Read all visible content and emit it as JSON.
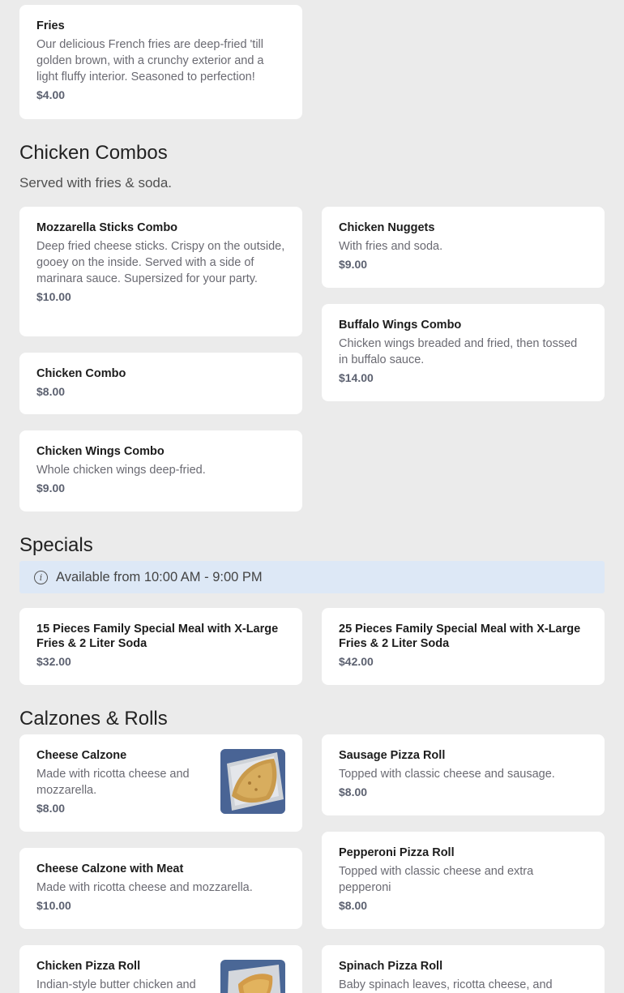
{
  "sections": {
    "sides": {
      "items": [
        {
          "name": "Fries",
          "desc": "Our delicious French fries are deep-fried 'till golden brown, with a crunchy exterior and a light fluffy interior. Seasoned to perfection!",
          "price": "$4.00"
        }
      ]
    },
    "chicken_combos": {
      "title": "Chicken Combos",
      "subtitle": "Served with fries & soda.",
      "items": [
        {
          "name": "Mozzarella Sticks Combo",
          "desc": "Deep fried cheese sticks. Crispy on the outside, gooey on the inside. Served with a side of marinara sauce. Supersized for your party.",
          "price": "$10.00"
        },
        {
          "name": "Chicken Nuggets",
          "desc": "With fries and soda.",
          "price": "$9.00"
        },
        {
          "name": "Buffalo Wings Combo",
          "desc": "Chicken wings breaded and fried, then tossed in buffalo sauce.",
          "price": "$14.00"
        },
        {
          "name": "Chicken Combo",
          "price": "$8.00"
        },
        {
          "name": "Chicken Wings Combo",
          "desc": "Whole chicken wings deep-fried.",
          "price": "$9.00"
        }
      ]
    },
    "specials": {
      "title": "Specials",
      "availability": "Available from 10:00 AM - 9:00 PM",
      "items": [
        {
          "name": "15 Pieces Family Special Meal with X-Large Fries & 2 Liter Soda",
          "price": "$32.00"
        },
        {
          "name": "25 Pieces Family Special Meal with X-Large Fries & 2 Liter Soda",
          "price": "$42.00"
        }
      ]
    },
    "calzones": {
      "title": "Calzones & Rolls",
      "items": [
        {
          "name": "Cheese Calzone",
          "desc": "Made with ricotta cheese and mozzarella.",
          "price": "$8.00"
        },
        {
          "name": "Sausage Pizza Roll",
          "desc": "Topped with classic cheese and sausage.",
          "price": "$8.00"
        },
        {
          "name": "Pepperoni Pizza Roll",
          "desc": "Topped with classic cheese and extra pepperoni",
          "price": "$8.00"
        },
        {
          "name": "Cheese Calzone with Meat",
          "desc": "Made with ricotta cheese and mozzarella.",
          "price": "$10.00"
        },
        {
          "name": "Chicken Pizza Roll",
          "desc": "Indian-style butter chicken and"
        },
        {
          "name": "Spinach Pizza Roll",
          "desc": "Baby spinach leaves, ricotta cheese, and"
        }
      ]
    }
  }
}
